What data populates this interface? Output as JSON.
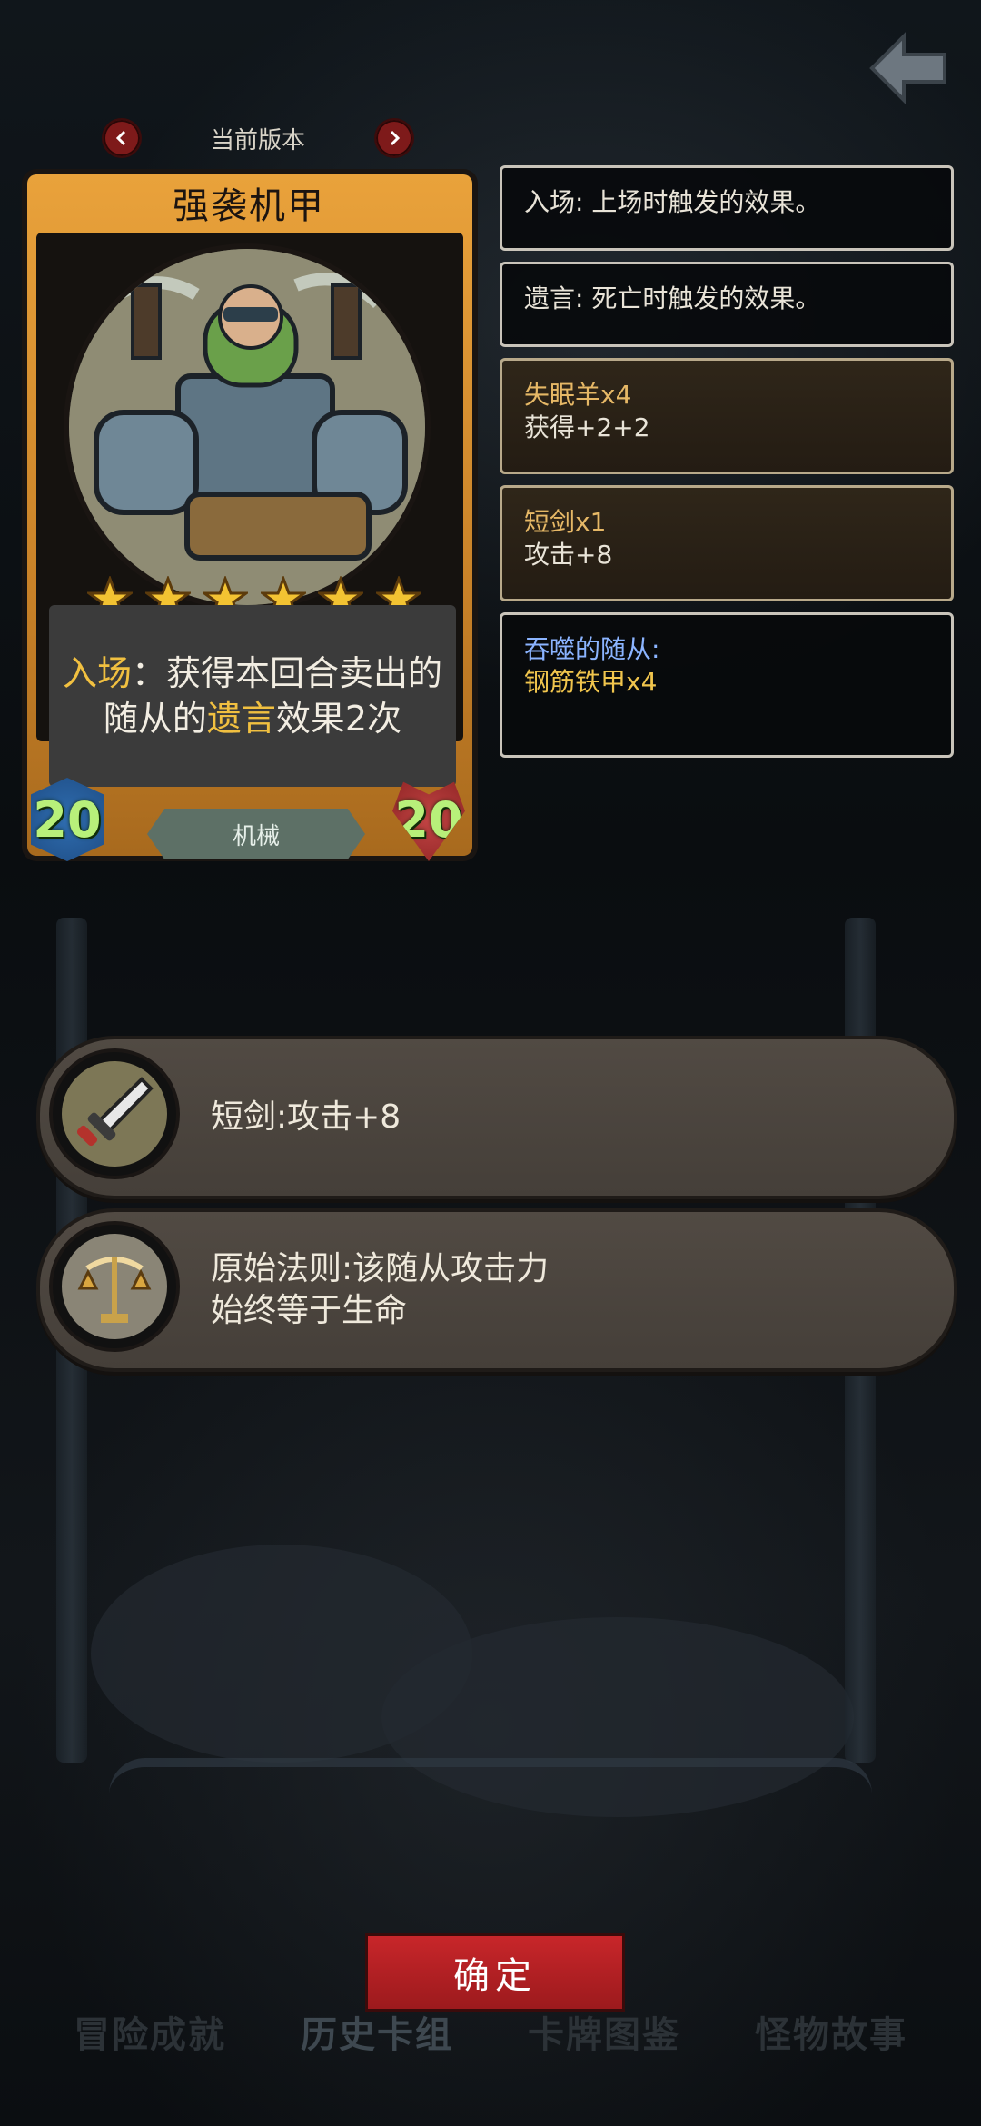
{
  "header": {
    "version_label": "当前版本"
  },
  "card": {
    "name": "强袭机甲",
    "stars": 6,
    "description": {
      "keyword1": "入场",
      "part1": "：获得本回合卖出的随从的",
      "keyword2": "遗言",
      "part2": "效果2次"
    },
    "attack": "20",
    "health": "20",
    "tribe": "机械"
  },
  "info_panels": [
    {
      "text": "入场: 上场时触发的效果。"
    },
    {
      "text": "遗言: 死亡时触发的效果。"
    },
    {
      "title": "失眠羊x4",
      "body": "获得+2+2"
    },
    {
      "title": "短剑x1",
      "body": "攻击+8"
    },
    {
      "title": "吞噬的随从:",
      "body": "钢筋铁甲x4"
    }
  ],
  "abilities": [
    {
      "icon": "dagger-icon",
      "text": "短剑:攻击+8"
    },
    {
      "icon": "scales-icon",
      "line1": "原始法则:该随从攻击力",
      "line2": "始终等于生命"
    }
  ],
  "confirm_label": "确定",
  "tabs": [
    "冒险成就",
    "历史卡组",
    "卡牌图鉴",
    "怪物故事"
  ],
  "colors": {
    "card_gold": "#e9a23b",
    "keyword_gold": "#f1c040",
    "confirm_red": "#c8262a",
    "attack_green": "#b8f07a"
  }
}
